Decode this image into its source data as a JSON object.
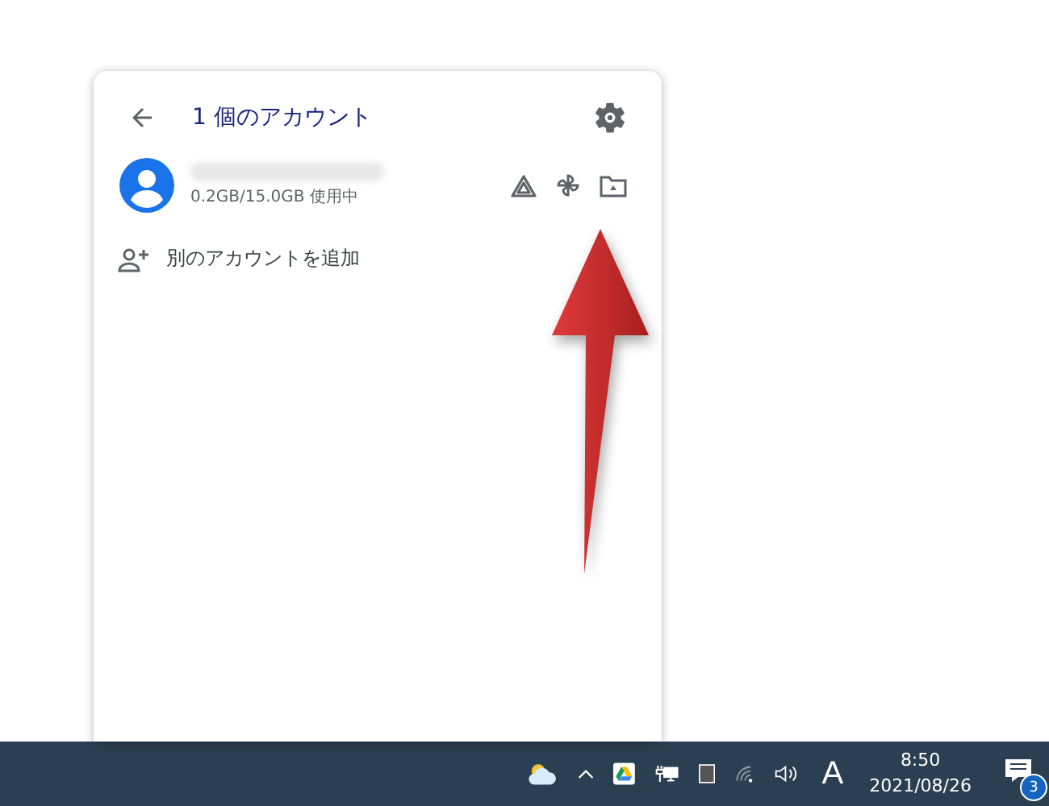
{
  "panel": {
    "title": "1 個のアカウント",
    "account": {
      "usage": "0.2GB/15.0GB 使用中"
    },
    "add_account": "別のアカウントを追加"
  },
  "taskbar": {
    "ime": "A",
    "time": "8:50",
    "date": "2021/08/26",
    "notification_count": "3"
  }
}
